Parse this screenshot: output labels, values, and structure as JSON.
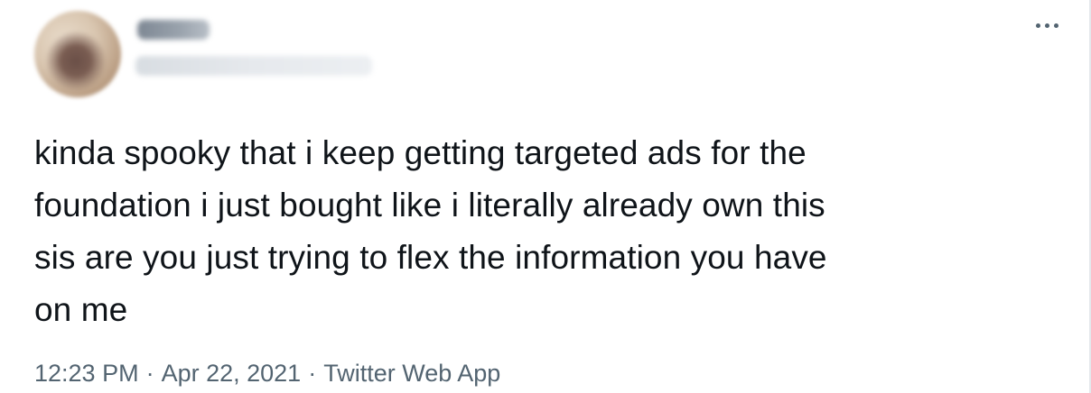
{
  "author": {
    "display_name": "",
    "handle": "",
    "avatar_icon": "profile-avatar"
  },
  "more_menu_icon": "more-horizontal-icon",
  "tweet": {
    "lines": [
      "kinda spooky that i keep getting targeted ads for the",
      "foundation i just bought like i literally already own this",
      "sis are you just trying to flex the information you have",
      "on me"
    ]
  },
  "meta": {
    "time": "12:23 PM",
    "separator": "·",
    "date": "Apr 22, 2021",
    "source": "Twitter Web App"
  }
}
